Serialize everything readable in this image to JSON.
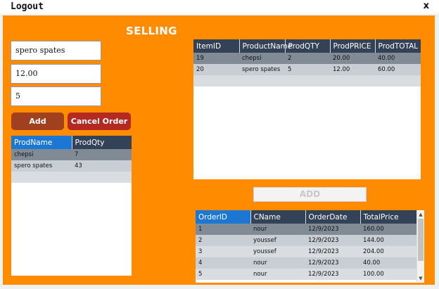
{
  "window": {
    "title": "Logout",
    "close": "x"
  },
  "heading": "SELLING",
  "form": {
    "product_name": "spero spates",
    "price": "12.00",
    "quantity": "5"
  },
  "buttons": {
    "add": "Add",
    "cancel": "Cancel Order",
    "add_to_order": "ADD"
  },
  "products": {
    "columns": [
      "ProdName",
      "ProdQty"
    ],
    "rows": [
      [
        "chepsi",
        "7"
      ],
      [
        "spero spates",
        "43"
      ]
    ]
  },
  "cart": {
    "columns": [
      "ItemID",
      "ProductName",
      "ProdQTY",
      "ProdPRICE",
      "ProdTOTAL"
    ],
    "rows": [
      [
        "19",
        "chepsi",
        "2",
        "20.00",
        "40.00"
      ],
      [
        "20",
        "spero spates",
        "5",
        "12.00",
        "60.00"
      ]
    ]
  },
  "orders": {
    "columns": [
      "OrderID",
      "CName",
      "OrderDate",
      "TotalPrice"
    ],
    "rows": [
      [
        "1",
        "nour",
        "12/9/2023",
        "160.00"
      ],
      [
        "2",
        "youssef",
        "12/9/2023",
        "144.00"
      ],
      [
        "3",
        "youssef",
        "12/9/2023",
        "204.00"
      ],
      [
        "4",
        "nour",
        "12/9/2023",
        "40.00"
      ],
      [
        "5",
        "nour",
        "12/9/2023",
        "100.00"
      ]
    ]
  },
  "scrollbar": {
    "up_icon": "▲",
    "down_icon": "▼"
  },
  "colors": {
    "panel": "#ff8c00",
    "header": "#334257",
    "header_selected": "#1b77d3"
  }
}
